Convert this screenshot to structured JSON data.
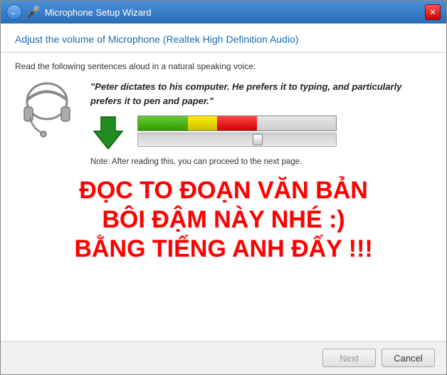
{
  "window": {
    "title": "Microphone Setup Wizard",
    "title_icon": "🎤"
  },
  "header": {
    "title": "Adjust the volume of Microphone (Realtek High Definition Audio)"
  },
  "content": {
    "instruction": "Read the following sentences aloud in a natural speaking voice:",
    "quote": "\"Peter dictates to his computer. He prefers it to typing, and particularly prefers it to pen and paper.\"",
    "note": "Note: After reading this, you can proceed to the next page.",
    "overlay_lines": [
      "ĐỌC TO ĐOẠN VĂN BẢN",
      "BÔI ĐẬM NÀY NHÉ :)",
      "BẰNG TIẾNG ANH ĐẤY !!!"
    ]
  },
  "footer": {
    "next_label": "Next",
    "cancel_label": "Cancel"
  }
}
